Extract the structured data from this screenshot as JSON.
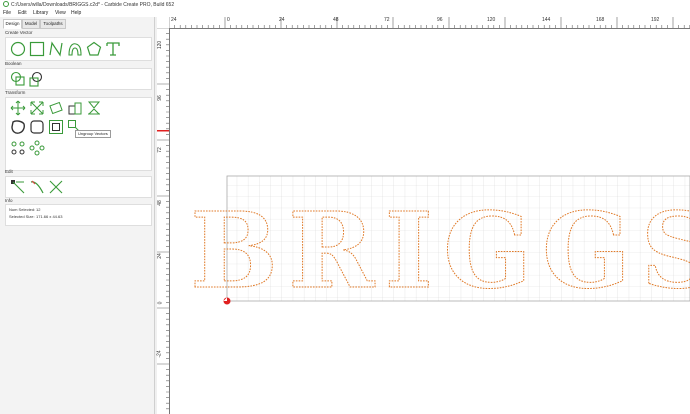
{
  "window": {
    "title": "C:/Users/willa/Downloads/BRIGGS.c2d* - Carbide Create PRO, Build 652"
  },
  "menu": [
    "File",
    "Edit",
    "Library",
    "View",
    "Help"
  ],
  "tabs": [
    "Design",
    "Model",
    "Toolpaths"
  ],
  "sections": {
    "create_vector": "Create Vector",
    "boolean": "Boolean",
    "transform": "Transform",
    "edit": "Edit",
    "info": "Info"
  },
  "tooltip": "Ungroup Vectors",
  "info": {
    "num_selected_label": "Num Selected:",
    "num_selected_value": "12",
    "selected_size_label": "Selected Size:",
    "selected_size_value": "171.66 x 44.63"
  },
  "ruler": {
    "x_labels": [
      "24",
      "0",
      "24",
      "48",
      "72",
      "96",
      "120",
      "144",
      "168",
      "192"
    ],
    "y_labels": [
      "120",
      "96",
      "72",
      "48",
      "24",
      "0",
      "-24"
    ]
  },
  "canvas": {
    "text": "BRIGGS"
  },
  "colors": {
    "accent_green": "#3a9a3a",
    "vector_orange": "#e07a28",
    "grid": "#d9d9d9",
    "origin_red": "#e02020"
  }
}
